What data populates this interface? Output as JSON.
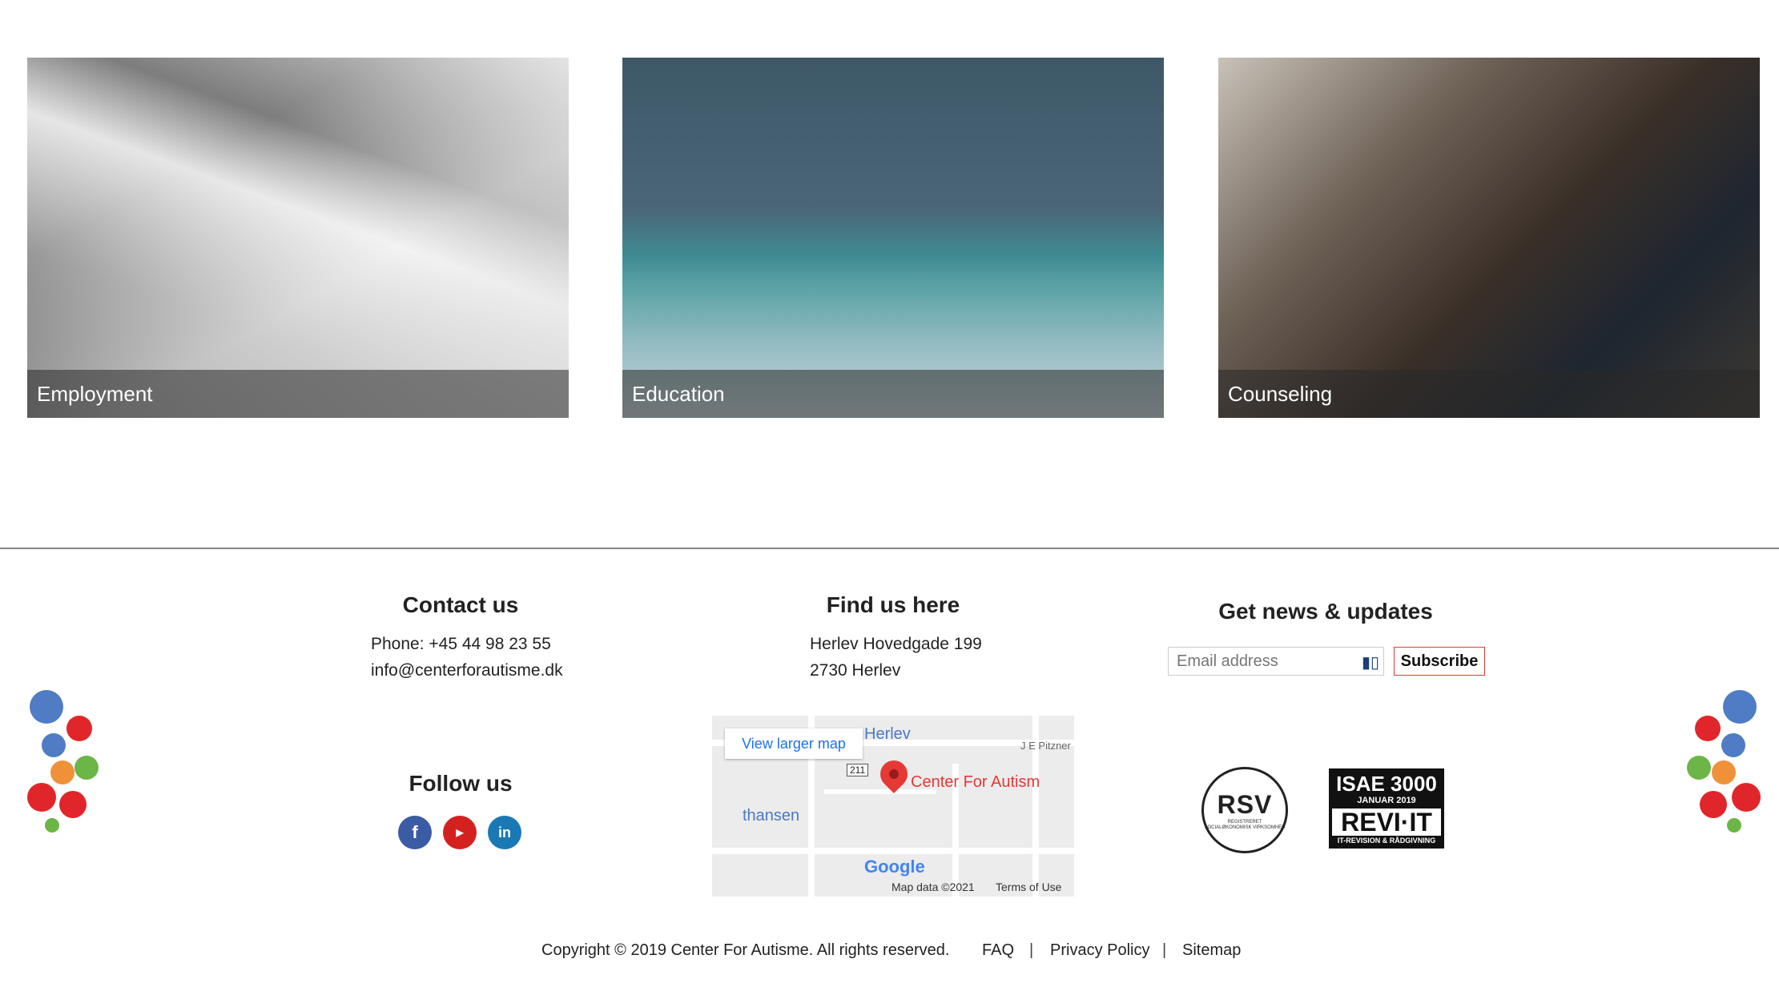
{
  "cards": [
    {
      "label": "Employment"
    },
    {
      "label": "Education"
    },
    {
      "label": "Counseling"
    }
  ],
  "contact": {
    "title": "Contact us",
    "phone": "Phone: +45 44 98 23 55",
    "email": "info@centerforautisme.dk"
  },
  "follow": {
    "title": "Follow us",
    "icons": [
      "facebook-icon",
      "youtube-icon",
      "linkedin-icon"
    ]
  },
  "find": {
    "title": "Find us here",
    "address1": "Herlev Hovedgade 199",
    "address2": "2730 Herlev"
  },
  "map": {
    "larger_link": "View larger map",
    "label_herlev": "Herlev",
    "label_thansen": "thansen",
    "label_pin": "Center For Autism",
    "label_road": "J E Pitzner",
    "road_number": "211",
    "map_data": "Map data ©2021",
    "terms": "Terms of Use",
    "google": "Google"
  },
  "news": {
    "title": "Get news & updates",
    "email_placeholder": "Email address",
    "subscribe_label": "Subscribe"
  },
  "certs": {
    "rsv_text": "RSV",
    "rsv_small": "REGISTRERET SOCIALØKONOMISK VIRKSOMHED",
    "isae_line1": "ISAE 3000",
    "isae_line2": "JANUAR 2019",
    "isae_line3": "REVI·IT",
    "isae_line4": "IT-REVISION & RÅDGIVNING"
  },
  "footer": {
    "copyright": "Copyright © 2019 Center For Autisme. All rights reserved.",
    "faq": "FAQ",
    "privacy": "Privacy Policy",
    "sitemap": "Sitemap",
    "separator": "|"
  },
  "colors": {
    "dot_blue": "#4f7cc4",
    "dot_red": "#e0262a",
    "dot_green": "#6cb547",
    "dot_orange": "#f0913a"
  }
}
